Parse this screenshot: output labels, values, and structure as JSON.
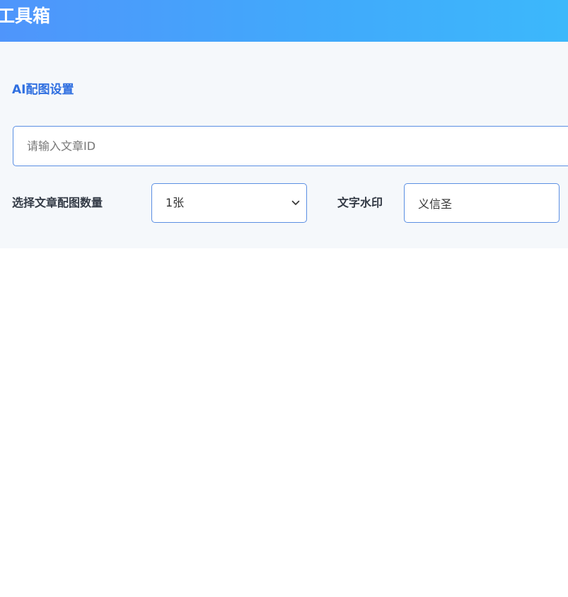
{
  "header": {
    "title": "工具箱"
  },
  "settings": {
    "section_title": "AI配图设置",
    "article_id": {
      "placeholder": "请输入文章ID",
      "value": ""
    },
    "image_count": {
      "label": "选择文章配图数量",
      "selected": "1张"
    },
    "watermark": {
      "label": "文字水印",
      "value": "义信圣"
    }
  },
  "colors": {
    "header_gradient_start": "#4f95fb",
    "header_gradient_end": "#3cb8fb",
    "accent": "#2f6fe0",
    "input_border": "#5b8fe3",
    "panel_background": "#f5f8fb"
  }
}
